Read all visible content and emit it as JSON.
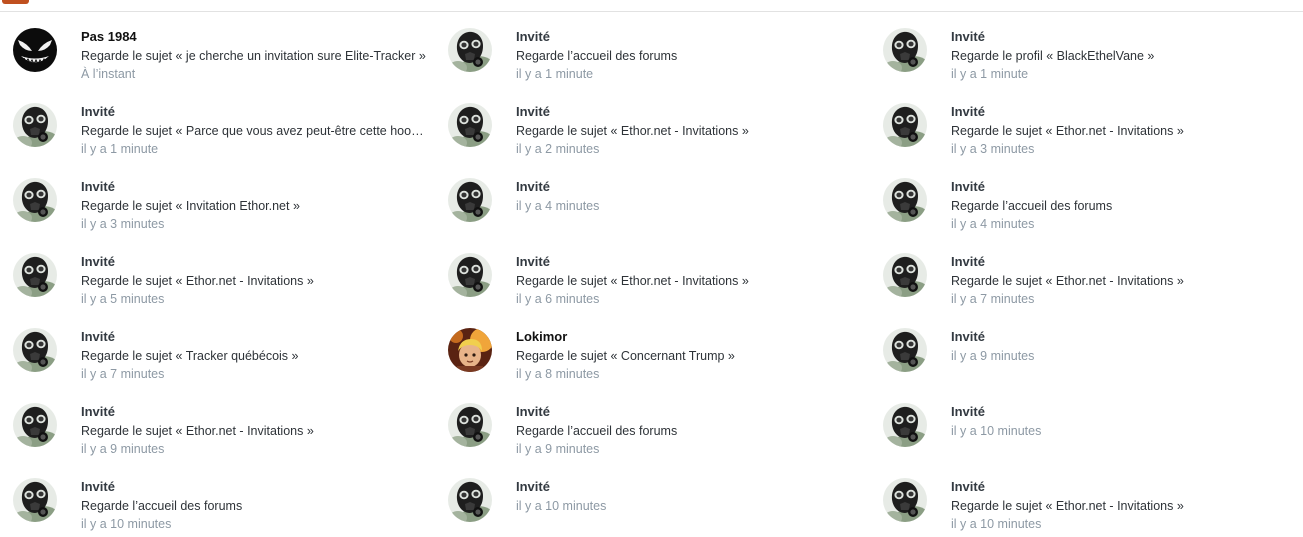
{
  "colors": {
    "accent": "#c0501f",
    "name_text": "#333a41",
    "activity_text": "#2e3338",
    "time_text": "#8d99a4",
    "divider": "#e2e2e2"
  },
  "columns": [
    {
      "entries": [
        {
          "name": "Pas 1984",
          "activity": "Regarde le sujet « je cherche un invitation sure Elite-Tracker »",
          "time": "À l’instant",
          "avatar": "venom-avatar-icon",
          "member": true
        },
        {
          "name": "Invité",
          "activity": "Regarde le sujet « Parce que vous avez peut-être cette hooka »",
          "time": "il y a 1 minute",
          "avatar": "gas-mask-avatar-icon"
        },
        {
          "name": "Invité",
          "activity": "Regarde le sujet « Invitation Ethor.net »",
          "time": "il y a 3 minutes",
          "avatar": "gas-mask-avatar-icon"
        },
        {
          "name": "Invité",
          "activity": "Regarde le sujet « Ethor.net - Invitations »",
          "time": "il y a 5 minutes",
          "avatar": "gas-mask-avatar-icon"
        },
        {
          "name": "Invité",
          "activity": "Regarde le sujet « Tracker québécois »",
          "time": "il y a 7 minutes",
          "avatar": "gas-mask-avatar-icon"
        },
        {
          "name": "Invité",
          "activity": "Regarde le sujet « Ethor.net - Invitations »",
          "time": "il y a 9 minutes",
          "avatar": "gas-mask-avatar-icon"
        },
        {
          "name": "Invité",
          "activity": "Regarde l’accueil des forums",
          "time": "il y a 10 minutes",
          "avatar": "gas-mask-avatar-icon"
        }
      ]
    },
    {
      "entries": [
        {
          "name": "Invité",
          "activity": "Regarde l’accueil des forums",
          "time": "il y a 1 minute",
          "avatar": "gas-mask-avatar-icon"
        },
        {
          "name": "Invité",
          "activity": "Regarde le sujet « Ethor.net - Invitations »",
          "time": "il y a 2 minutes",
          "avatar": "gas-mask-avatar-icon"
        },
        {
          "name": "Invité",
          "activity": "",
          "time": "il y a 4 minutes",
          "avatar": "gas-mask-avatar-icon"
        },
        {
          "name": "Invité",
          "activity": "Regarde le sujet « Ethor.net - Invitations »",
          "time": "il y a 6 minutes",
          "avatar": "gas-mask-avatar-icon"
        },
        {
          "name": "Lokimor",
          "activity": "Regarde le sujet « Concernant Trump »",
          "time": "il y a 8 minutes",
          "avatar": "cartoon-character-avatar-icon",
          "member": true
        },
        {
          "name": "Invité",
          "activity": "Regarde l’accueil des forums",
          "time": "il y a 9 minutes",
          "avatar": "gas-mask-avatar-icon"
        },
        {
          "name": "Invité",
          "activity": "",
          "time": "il y a 10 minutes",
          "avatar": "gas-mask-avatar-icon"
        }
      ]
    },
    {
      "entries": [
        {
          "name": "Invité",
          "activity": "Regarde le profil « BlackEthelVane »",
          "time": "il y a 1 minute",
          "avatar": "gas-mask-avatar-icon"
        },
        {
          "name": "Invité",
          "activity": "Regarde le sujet « Ethor.net - Invitations »",
          "time": "il y a 3 minutes",
          "avatar": "gas-mask-avatar-icon"
        },
        {
          "name": "Invité",
          "activity": "Regarde l’accueil des forums",
          "time": "il y a 4 minutes",
          "avatar": "gas-mask-avatar-icon"
        },
        {
          "name": "Invité",
          "activity": "Regarde le sujet « Ethor.net - Invitations »",
          "time": "il y a 7 minutes",
          "avatar": "gas-mask-avatar-icon"
        },
        {
          "name": "Invité",
          "activity": "",
          "time": "il y a 9 minutes",
          "avatar": "gas-mask-avatar-icon"
        },
        {
          "name": "Invité",
          "activity": "",
          "time": "il y a 10 minutes",
          "avatar": "gas-mask-avatar-icon"
        },
        {
          "name": "Invité",
          "activity": "Regarde le sujet « Ethor.net - Invitations »",
          "time": "il y a 10 minutes",
          "avatar": "gas-mask-avatar-icon"
        }
      ]
    }
  ]
}
